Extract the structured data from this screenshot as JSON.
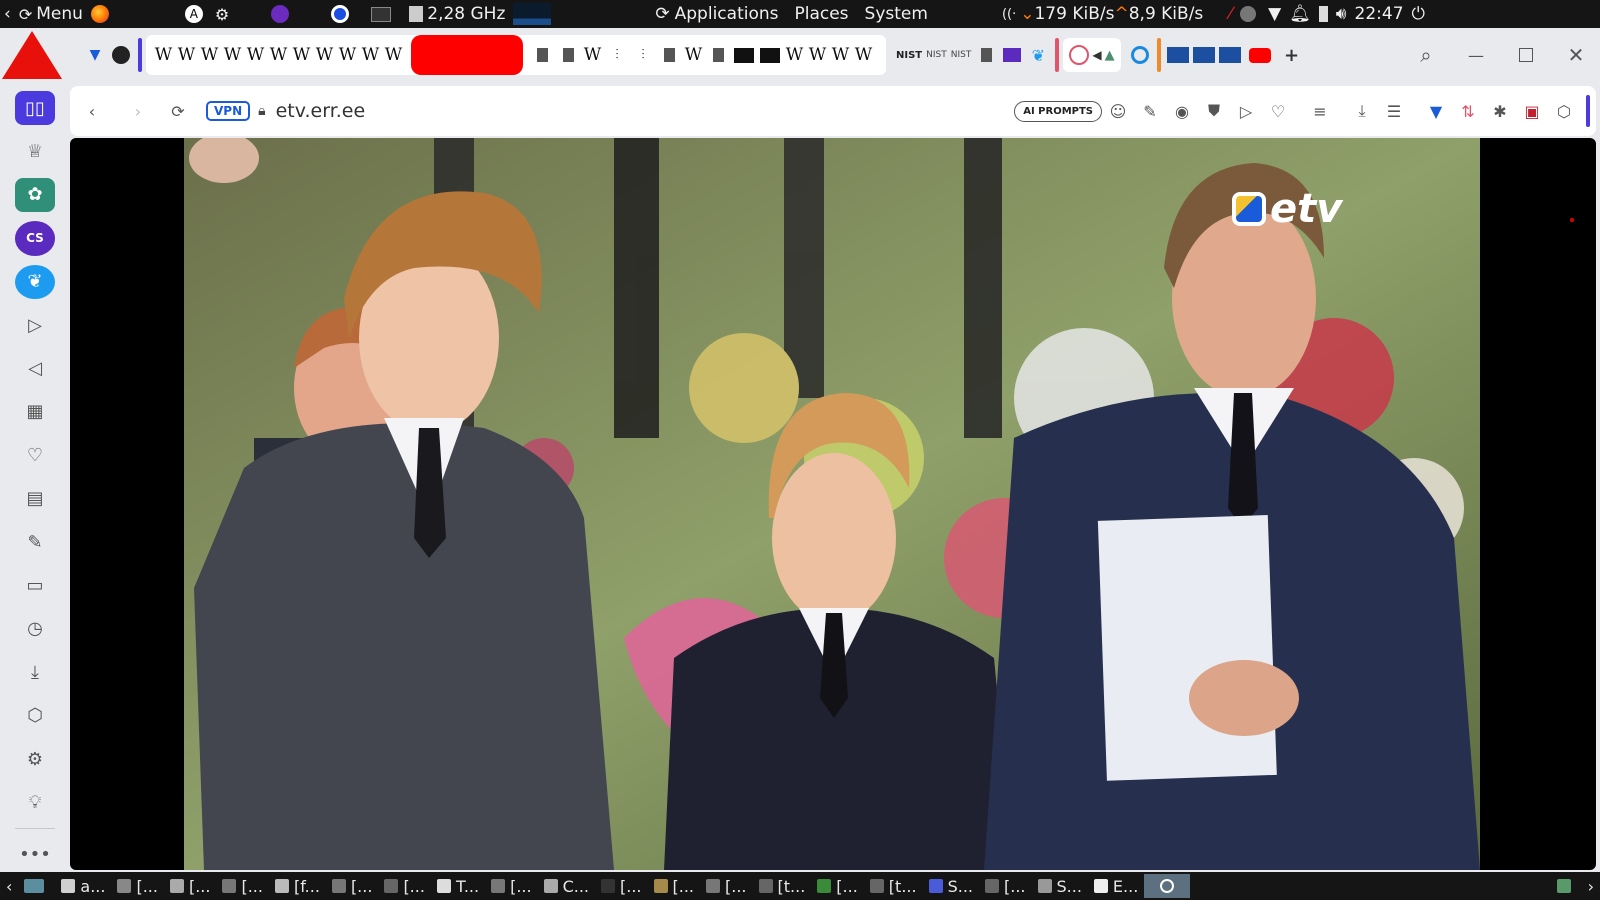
{
  "system_panel": {
    "menu_label": "Menu",
    "cpu_freq": "2,28 GHz",
    "applications_label": "Applications",
    "places_label": "Places",
    "system_label": "System",
    "net_down": "179 KiB/s",
    "net_up": "8,9 KiB/s",
    "clock": "22:47"
  },
  "tabs": {
    "w_glyph": "W",
    "nist_label": "NIST"
  },
  "addressbar": {
    "vpn_label": "VPN",
    "url": "etv.err.ee",
    "ai_prompts_label": "AI PROMPTS"
  },
  "video": {
    "logo_text": "etv"
  },
  "taskbar": {
    "items": [
      "a...",
      "[...",
      "[...",
      "[...",
      "[f...",
      "[...",
      "[...",
      "T...",
      "[...",
      "C...",
      "[...",
      "[...",
      "[...",
      "[t...",
      "[...",
      "[t...",
      "S...",
      "[...",
      "S...",
      "E..."
    ]
  },
  "colors": {
    "panel_bg": "#151515",
    "browser_bg": "#e9eaee",
    "accent": "#4b3bdf",
    "etv_logo": "#ffffff"
  }
}
